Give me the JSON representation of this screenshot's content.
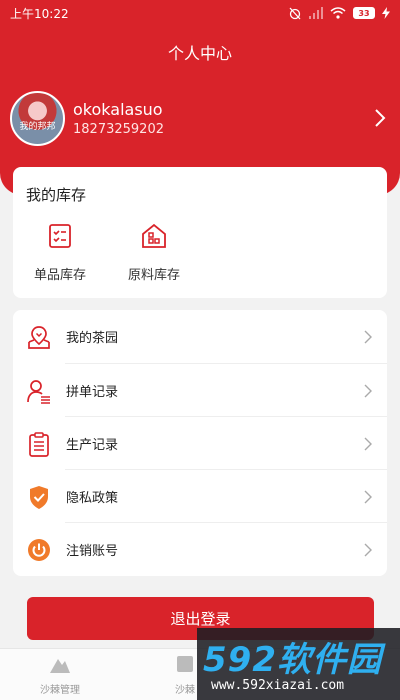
{
  "status_bar": {
    "time": "上午10:22",
    "battery": "33"
  },
  "header": {
    "title": "个人中心"
  },
  "profile": {
    "avatar_caption": "我的邦邦",
    "username": "okokalasuo",
    "phone": "18273259202"
  },
  "inventory": {
    "title": "我的库存",
    "items": [
      {
        "label": "单品库存",
        "icon": "checklist-icon"
      },
      {
        "label": "原料库存",
        "icon": "warehouse-icon"
      }
    ]
  },
  "menu": [
    {
      "label": "我的茶园",
      "icon": "map-pin-icon"
    },
    {
      "label": "拼单记录",
      "icon": "user-list-icon"
    },
    {
      "label": "生产记录",
      "icon": "clipboard-icon"
    },
    {
      "label": "隐私政策",
      "icon": "shield-check-icon"
    },
    {
      "label": "注销账号",
      "icon": "power-icon"
    }
  ],
  "logout_label": "退出登录",
  "tabs": [
    {
      "label": "沙棘管理"
    },
    {
      "label": "沙棘"
    }
  ],
  "watermark": {
    "brand": "592软件园",
    "url": "www.592xiazai.com"
  },
  "colors": {
    "accent": "#d9232a",
    "background": "#f2f2f2"
  }
}
